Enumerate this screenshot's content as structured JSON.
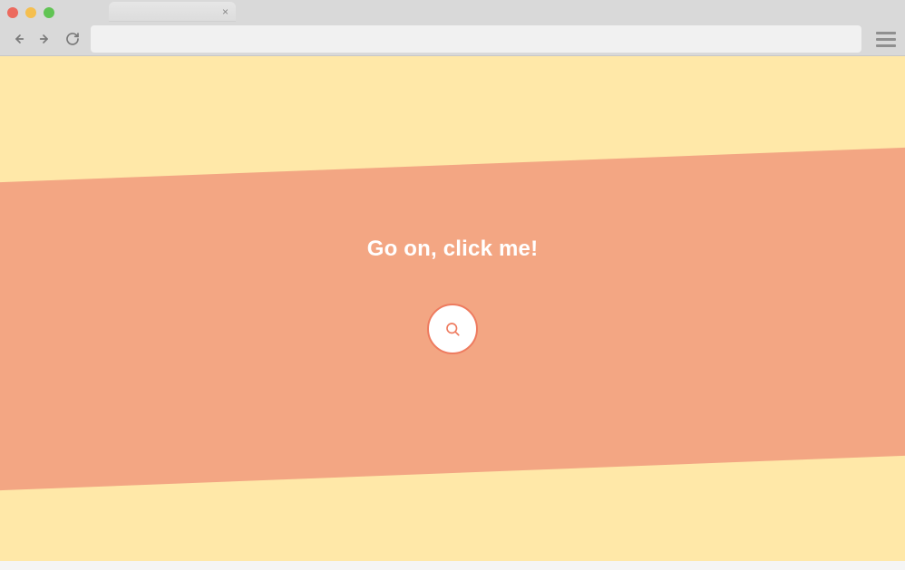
{
  "browser": {
    "tab_close_glyph": "×",
    "url_value": "",
    "url_placeholder": ""
  },
  "content": {
    "headline": "Go on, click me!"
  }
}
